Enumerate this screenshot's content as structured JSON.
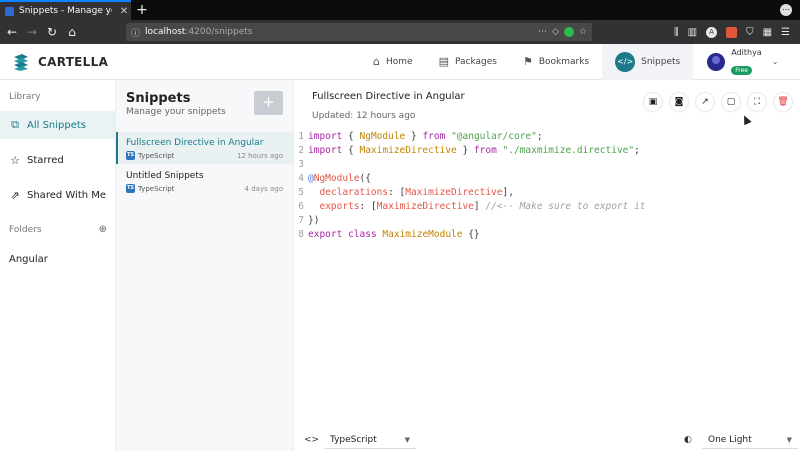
{
  "browser": {
    "tab_title": "Snippets - Manage your co",
    "new_tab": "+",
    "url_host": "localhost",
    "url_path": ":4200/snippets"
  },
  "app": {
    "brand": "CARTELLA",
    "nav": [
      {
        "label": "Home",
        "icon": "home-icon",
        "glyph": "⌂"
      },
      {
        "label": "Packages",
        "icon": "package-icon",
        "glyph": "▤"
      },
      {
        "label": "Bookmarks",
        "icon": "bookmark-icon",
        "glyph": "⚑"
      },
      {
        "label": "Snippets",
        "icon": "code-icon",
        "glyph": "</>"
      }
    ],
    "user": {
      "name": "Adithya",
      "plan": "Free"
    }
  },
  "sidebar": {
    "library_label": "Library",
    "items": [
      {
        "label": "All Snippets",
        "glyph": "⧉"
      },
      {
        "label": "Starred",
        "glyph": "☆"
      },
      {
        "label": "Shared With Me",
        "glyph": "⇗"
      }
    ],
    "folders_label": "Folders",
    "folders": [
      {
        "label": "Angular"
      }
    ]
  },
  "list": {
    "title": "Snippets",
    "subtitle": "Manage your snippets",
    "add": "+",
    "snippets": [
      {
        "name": "Fullscreen Directive in Angular",
        "lang": "TypeScript",
        "badge": "TS",
        "when": "12 hours ago"
      },
      {
        "name": "Untitled Snippets",
        "lang": "TypeScript",
        "badge": "TS",
        "when": "4 days ago"
      }
    ]
  },
  "editor": {
    "title": "Fullscreen Directive in Angular",
    "updated": "Updated: 12 hours ago",
    "line_numbers": [
      "1",
      "2",
      "3",
      "4",
      "5",
      "6",
      "7",
      "8"
    ],
    "code_lines": [
      [
        {
          "t": "import",
          "c": "kw"
        },
        {
          "t": " { ",
          "c": ""
        },
        {
          "t": "NgModule",
          "c": "nm"
        },
        {
          "t": " } ",
          "c": ""
        },
        {
          "t": "from",
          "c": "kw"
        },
        {
          "t": " ",
          "c": ""
        },
        {
          "t": "\"@angular/core\"",
          "c": "st"
        },
        {
          "t": ";",
          "c": ""
        }
      ],
      [
        {
          "t": "import",
          "c": "kw"
        },
        {
          "t": " { ",
          "c": ""
        },
        {
          "t": "MaximizeDirective",
          "c": "nm"
        },
        {
          "t": " } ",
          "c": ""
        },
        {
          "t": "from",
          "c": "kw"
        },
        {
          "t": " ",
          "c": ""
        },
        {
          "t": "\"./maxmimize.directive\"",
          "c": "st"
        },
        {
          "t": ";",
          "c": ""
        }
      ],
      [],
      [
        {
          "t": "@",
          "c": "dc"
        },
        {
          "t": "NgModule",
          "c": "pr"
        },
        {
          "t": "({",
          "c": ""
        }
      ],
      [
        {
          "t": "  ",
          "c": ""
        },
        {
          "t": "declarations",
          "c": "pr"
        },
        {
          "t": ": [",
          "c": ""
        },
        {
          "t": "MaximizeDirective",
          "c": "pr"
        },
        {
          "t": "],",
          "c": ""
        }
      ],
      [
        {
          "t": "  ",
          "c": ""
        },
        {
          "t": "exports",
          "c": "pr"
        },
        {
          "t": ": [",
          "c": ""
        },
        {
          "t": "MaximizeDirective",
          "c": "pr"
        },
        {
          "t": "] ",
          "c": ""
        },
        {
          "t": "//<-- Make sure to export it",
          "c": "cm"
        }
      ],
      [
        {
          "t": "})",
          "c": ""
        }
      ],
      [
        {
          "t": "export",
          "c": "kw"
        },
        {
          "t": " ",
          "c": ""
        },
        {
          "t": "class",
          "c": "kw"
        },
        {
          "t": " ",
          "c": ""
        },
        {
          "t": "MaximizeModule",
          "c": "nm"
        },
        {
          "t": " {}",
          "c": ""
        }
      ]
    ],
    "language": "TypeScript",
    "theme": "One Light",
    "tools": [
      {
        "name": "save-icon",
        "glyph": "▣"
      },
      {
        "name": "screenshot-icon",
        "glyph": "◙"
      },
      {
        "name": "share-icon",
        "glyph": "↗"
      },
      {
        "name": "clipboard-icon",
        "glyph": "▢"
      },
      {
        "name": "fullscreen-icon",
        "glyph": "⛶"
      },
      {
        "name": "delete-icon",
        "glyph": "🗑"
      }
    ]
  }
}
